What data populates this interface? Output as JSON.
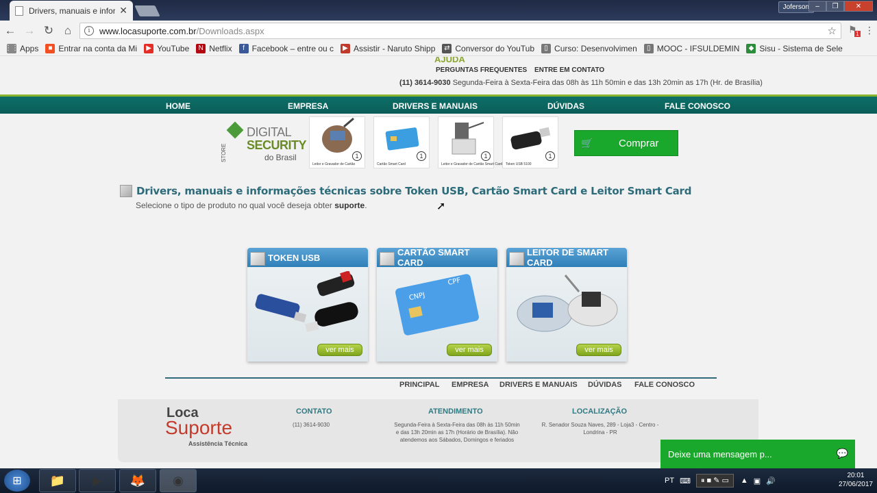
{
  "browser": {
    "tab_title": "Drivers, manuais e informa",
    "tab_close": "✕",
    "user": "Joferson",
    "url_host": "www.locasuporte.com.br",
    "url_path": "/Downloads.aspx",
    "window_buttons": [
      "–",
      "❐",
      "✕"
    ]
  },
  "bookmarks": [
    {
      "label": "Apps",
      "icon": "apps-icon",
      "color": "#888"
    },
    {
      "label": "Entrar na conta da Mi",
      "icon": "microsoft-icon",
      "color": "#f25022"
    },
    {
      "label": "YouTube",
      "icon": "youtube-icon",
      "color": "#e52d27"
    },
    {
      "label": "Netflix",
      "icon": "netflix-icon",
      "color": "#b20710"
    },
    {
      "label": "Facebook – entre ou c",
      "icon": "facebook-icon",
      "color": "#3b5998"
    },
    {
      "label": "Assistir - Naruto Shipp",
      "icon": "play-icon",
      "color": "#c0392b"
    },
    {
      "label": "Conversor do YouTub",
      "icon": "convert-icon",
      "color": "#555"
    },
    {
      "label": "Curso: Desenvolvimen",
      "icon": "page-icon",
      "color": "#777"
    },
    {
      "label": "MOOC - IFSULDEMIN",
      "icon": "page-icon",
      "color": "#777"
    },
    {
      "label": "Sisu - Sistema de Sele",
      "icon": "flag-icon",
      "color": "#2c8c3c"
    }
  ],
  "header": {
    "help": "AJUDA",
    "faq": "PERGUNTAS FREQUENTES",
    "contact": "ENTRE EM CONTATO",
    "phone": "(11) 3614-9030",
    "hours": "Segunda-Feira à Sexta-Feira das 08h às 11h 50min e das 13h 20min as 17h (Hr. de Brasília)"
  },
  "nav": [
    "HOME",
    "EMPRESA",
    "DRIVERS E MANUAIS",
    "DÚVIDAS",
    "FALE CONOSCO"
  ],
  "store": {
    "label": "STORE",
    "line1": "DIGITAL",
    "line2": "SECURITY",
    "line3": "do Brasil",
    "thumbs": [
      {
        "caption": "Leitor e Gravador de Cartão",
        "num": "1"
      },
      {
        "caption": "Cartão Smart Card",
        "num": "1"
      },
      {
        "caption": "Leitor e Gravador de Cartão Smart Card",
        "num": "1"
      },
      {
        "caption": "Token USB 5100",
        "num": "1"
      }
    ],
    "buy": "Comprar"
  },
  "main": {
    "title": "Drivers, manuais e informações técnicas sobre Token USB, Cartão Smart Card e Leitor Smart Card",
    "subtitle_pre": "Selecione o tipo de produto no qual você deseja obter",
    "subtitle_bold": "suporte",
    "subtitle_post": ".",
    "cards": [
      {
        "title": "TOKEN USB",
        "more": "ver mais"
      },
      {
        "title": "CARTÃO SMART CARD",
        "more": "ver mais"
      },
      {
        "title": "LEITOR DE SMART CARD",
        "more": "ver mais"
      }
    ]
  },
  "footer": {
    "nav": [
      "PRINCIPAL",
      "EMPRESA",
      "DRIVERS E MANUAIS",
      "DÚVIDAS",
      "FALE CONOSCO"
    ],
    "logo1": "Loca",
    "logo2": "Suporte",
    "logo3": "Assistência Técnica",
    "contact_title": "CONTATO",
    "contact_text": "(11) 3614-9030",
    "hours_title": "ATENDIMENTO",
    "hours_text": "Segunda-Feira à Sexta-Feira das 08h às 11h 50min e das 13h 20min as 17h (Horário de Brasília). Não atendemos aos Sábados, Domingos e feriados",
    "location_title": "LOCALIZAÇÃO",
    "location_text": "R. Senador Souza Naves, 289 - Loja3 - Centro - Londrina - PR"
  },
  "chat": "Deixe uma mensagem p...",
  "taskbar": {
    "lang": "PT",
    "time": "20:01",
    "date": "27/06/2017"
  },
  "colors": {
    "nav": "#0b5d58",
    "accent": "#8ab42d",
    "buy": "#1aa82c",
    "card_header": "#2f7fb8"
  }
}
